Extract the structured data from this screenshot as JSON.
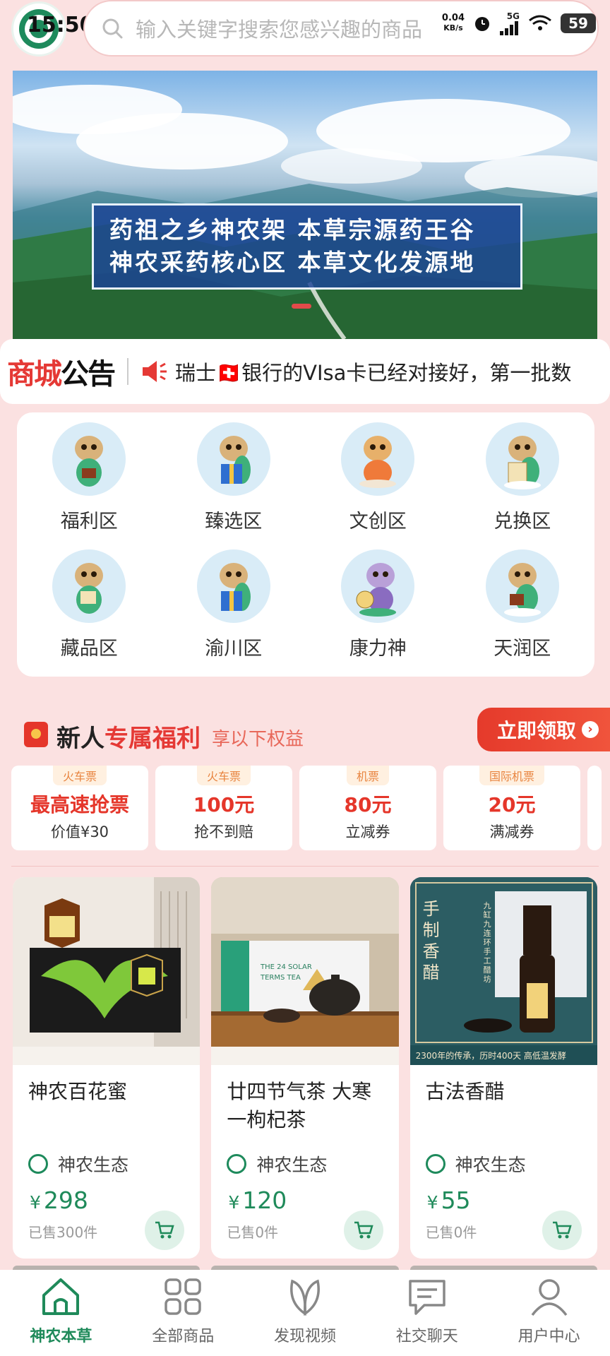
{
  "status_bar": {
    "time": "15:50",
    "net_speed": "0.04",
    "net_unit": "KB/s",
    "signal": "5G",
    "wifi_level": "6",
    "battery": "59"
  },
  "search": {
    "placeholder": "输入关键字搜索您感兴趣的商品"
  },
  "banner": {
    "line1": "药祖之乡神农架  本草宗源药王谷",
    "line2": "神农采药核心区  本草文化发源地"
  },
  "notice": {
    "title_red": "商城",
    "title_black": "公告",
    "text": "瑞士🇨🇭银行的VIsa卡已经对接好，第一批数"
  },
  "categories": [
    {
      "label": "福利区",
      "icon": "dragon-mascot-icon"
    },
    {
      "label": "臻选区",
      "icon": "dragon-gift-icon"
    },
    {
      "label": "文创区",
      "icon": "dragon-mascot-icon"
    },
    {
      "label": "兑换区",
      "icon": "dragon-scroll-icon"
    },
    {
      "label": "藏品区",
      "icon": "dragon-mascot-icon"
    },
    {
      "label": "渝川区",
      "icon": "dragon-gift-icon"
    },
    {
      "label": "康力神",
      "icon": "dragon-clock-icon"
    },
    {
      "label": "天润区",
      "icon": "dragon-mascot-icon"
    }
  ],
  "newbie": {
    "title_black": "新人",
    "title_red": "专属福利",
    "subtitle": "享以下权益",
    "claim_label": "立即领取"
  },
  "coupons": [
    {
      "tag": "火车票",
      "value": "最高速抢票",
      "desc": "价值¥30"
    },
    {
      "tag": "火车票",
      "value": "100元",
      "desc": "抢不到赔"
    },
    {
      "tag": "机票",
      "value": "80元",
      "desc": "立减券"
    },
    {
      "tag": "国际机票",
      "value": "20元",
      "desc": "满减券"
    }
  ],
  "products": [
    {
      "name": "神农百花蜜",
      "shop": "神农生态",
      "currency": "¥",
      "price": "298",
      "sold": "已售300件"
    },
    {
      "name": "廿四节气茶 大寒一枸杞茶",
      "shop": "神农生态",
      "currency": "¥",
      "price": "120",
      "sold": "已售0件"
    },
    {
      "name": "古法香醋",
      "shop": "神农生态",
      "currency": "¥",
      "price": "55",
      "sold": "已售0件"
    }
  ],
  "product3_image_text": {
    "left_brand": "手制香醋",
    "vertical_brand": "九缸九连环手工醋坊",
    "caption": "2300年的传承，历时400天 高低温发酵"
  },
  "nav": [
    {
      "label": "神农本草",
      "icon": "home-icon",
      "active": true
    },
    {
      "label": "全部商品",
      "icon": "grid-icon",
      "active": false
    },
    {
      "label": "发现视频",
      "icon": "leaf-icon",
      "active": false
    },
    {
      "label": "社交聊天",
      "icon": "chat-icon",
      "active": false
    },
    {
      "label": "用户中心",
      "icon": "user-icon",
      "active": false
    }
  ],
  "colors": {
    "accent_green": "#1f8a5a",
    "accent_red": "#e53935",
    "page_bg": "#fbe1e1"
  }
}
